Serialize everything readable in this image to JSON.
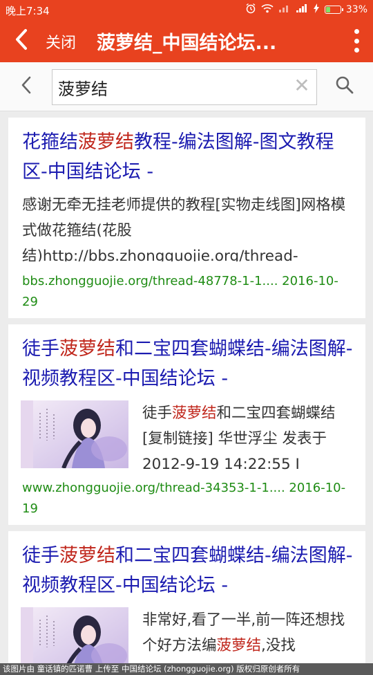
{
  "status_bar": {
    "time": "晚上7:34",
    "battery": "33%",
    "battery_level": 0.33,
    "icons": [
      "alarm-icon",
      "wifi-icon",
      "signal-hd-icon",
      "signal-icon",
      "charging-icon",
      "battery-icon"
    ]
  },
  "app_bar": {
    "back_icon": "chevron-left-icon",
    "close_label": "关闭",
    "title": "菠萝结_中国结论坛",
    "more_icon": "more-vertical-icon",
    "background": "#e8421f"
  },
  "search": {
    "back_icon": "chevron-left-icon",
    "query": "菠萝结",
    "clear_icon": "clear-icon",
    "search_icon": "search-icon"
  },
  "results": [
    {
      "title_parts": [
        "花箍结",
        "菠萝结",
        "教程-编法图解-图文教程区-中国结论坛 -"
      ],
      "snippet_parts": [
        "感谢无牵无挂老师提供的教程[实物走线图]网格模式做花箍结(花股结)http://bbs.zhongguojie.org/thread-"
      ],
      "url": "bbs.zhongguojie.org/thread-48778-1-1.... 2016-10-29"
    },
    {
      "title_parts": [
        "徒手",
        "菠萝结",
        "和二宝四套蝴蝶结-编法图解-视频教程区-中国结论坛 -"
      ],
      "snippet_parts": [
        "徒手",
        "菠萝结",
        "和二宝四套蝴蝶结 [复制链接] 华世浮尘 发表于 2012-9-19 14:22:55 I"
      ],
      "url": "www.zhongguojie.org/thread-34353-1-1.... 2016-10-19"
    },
    {
      "title_parts": [
        "徒手",
        "菠萝结",
        "和二宝四套蝴蝶结-编法图解-视频教程区-中国结论坛 -"
      ],
      "snippet_parts": [
        "非常好,看了一半,前一阵还想找个好方法编",
        "菠萝结",
        ",没找"
      ],
      "url": ""
    }
  ],
  "colors": {
    "title_link": "#1b1bb0",
    "highlight": "#c0271c",
    "url": "#1f8c14"
  },
  "footer": {
    "text": "该图片由 童话镇的匹诺曹 上传至 中国结论坛 (zhongguojie.org) 版权归原创者所有"
  }
}
